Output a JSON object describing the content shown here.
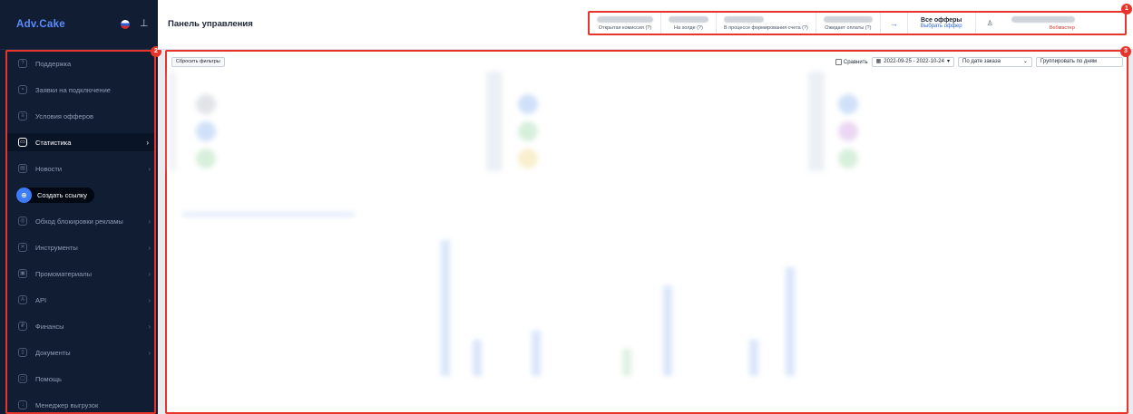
{
  "app": {
    "logo": "Adv.Cake"
  },
  "header": {
    "title": "Панель управления",
    "stats": [
      {
        "label": "Открытая комиссия (?)"
      },
      {
        "label": "На холде (?)"
      },
      {
        "label": "В процессе формирования счета (?)"
      },
      {
        "label": "Ожидает оплаты (?)"
      }
    ],
    "offer_title": "Все офферы",
    "offer_link": "Выбрать оффер",
    "user_role": "Вебмастер",
    "arrow": "→"
  },
  "sidebar": {
    "items": [
      {
        "label": "Поддержка",
        "icon": "help-icon"
      },
      {
        "label": "Заявки на подключение",
        "icon": "users-icon"
      },
      {
        "label": "Условия офферов",
        "icon": "document-icon"
      },
      {
        "label": "Статистика",
        "icon": "chart-icon",
        "active": true
      },
      {
        "label": "Новости",
        "icon": "news-icon"
      },
      {
        "label": "Обход блокировки рекламы",
        "icon": "shield-icon"
      },
      {
        "label": "Инструменты",
        "icon": "tools-icon"
      },
      {
        "label": "Промоматериалы",
        "icon": "gift-icon"
      },
      {
        "label": "API",
        "icon": "api-icon"
      },
      {
        "label": "Финансы",
        "icon": "coin-icon"
      },
      {
        "label": "Документы",
        "icon": "file-icon"
      },
      {
        "label": "Помощь",
        "icon": "chat-icon"
      },
      {
        "label": "Менеджер выгрузок",
        "icon": "download-icon"
      }
    ],
    "cta": "Создать ссылку"
  },
  "filters": {
    "reset": "Сбросить фильтры",
    "compare": "Сравнить",
    "date_range": "2022-09-25 - 2022-10-24",
    "date_type": "По дате заказа",
    "grouping": "Группировать по дням"
  },
  "badges": {
    "b1": "1",
    "b2": "2",
    "b3": "3"
  },
  "colors": {
    "accent": "#2f66e0",
    "sidebar_bg": "#111d33",
    "highlight": "#e8352b"
  }
}
